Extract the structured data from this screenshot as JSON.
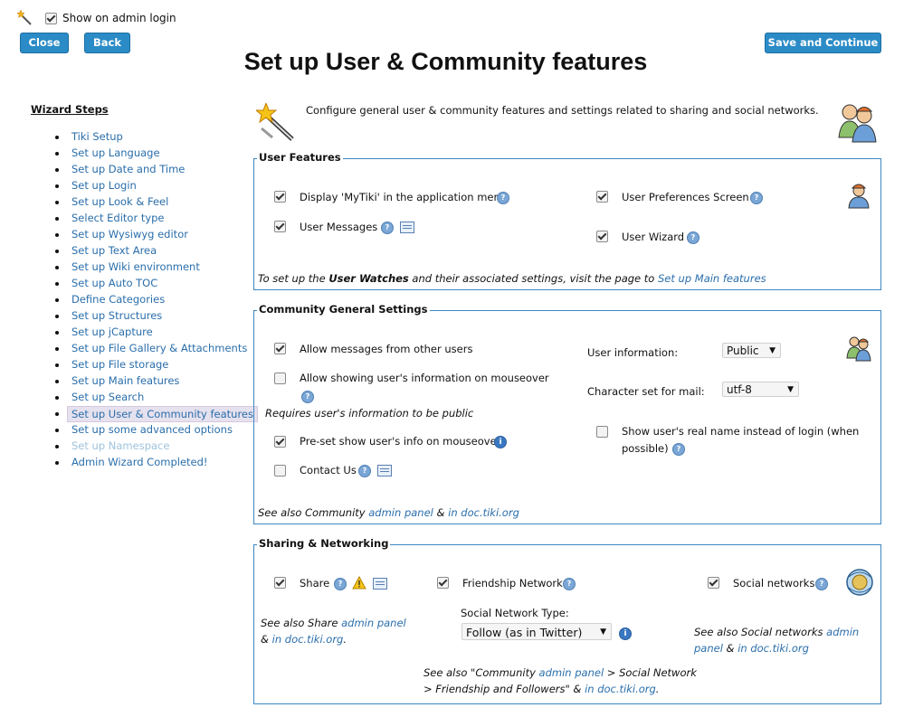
{
  "top": {
    "show_on_admin_login": "Show on admin login",
    "close_label": "Close",
    "back_label": "Back",
    "save_label": "Save and Continue"
  },
  "page_title": "Set up User & Community features",
  "intro": "Configure general user & community features and settings related to sharing and social networks.",
  "wizard_steps": {
    "heading": "Wizard Steps",
    "items": [
      "Tiki Setup",
      "Set up Language",
      "Set up Date and Time",
      "Set up Login",
      "Set up Look & Feel",
      "Select Editor type",
      "Set up Wysiwyg editor",
      "Set up Text Area",
      "Set up Wiki environment",
      "Set up Auto TOC",
      "Define Categories",
      "Set up Structures",
      "Set up jCapture",
      "Set up File Gallery & Attachments",
      "Set up File storage",
      "Set up Main features",
      "Set up Search",
      "Set up User & Community features",
      "Set up some advanced options",
      "Set up Namespace",
      "Admin Wizard Completed!"
    ],
    "active_index": 17,
    "disabled_index": 19
  },
  "user_features": {
    "legend": "User Features",
    "display_mytiki": "Display 'MyTiki' in the application menu",
    "user_messages": "User Messages",
    "user_prefs": "User Preferences Screen",
    "user_wizard": "User Wizard",
    "note_prefix": "To set up the ",
    "note_bold": "User Watches",
    "note_mid": " and their associated settings, visit the page to ",
    "note_link": "Set up Main features"
  },
  "community": {
    "legend": "Community General Settings",
    "allow_messages": "Allow messages from other users",
    "allow_showing": "Allow showing user's information on mouseover",
    "requires_public": "Requires user's information to be public",
    "preset_show": "Pre-set show user's info on mouseover",
    "contact_us": "Contact Us",
    "user_information_label": "User information:",
    "user_information_value": "Public",
    "charset_label": "Character set for mail:",
    "charset_value": "utf-8",
    "real_name_line1": "Show user's real name instead of login (when",
    "real_name_line2": "possible)",
    "see_also_prefix": "See also Community ",
    "admin_panel": "admin panel",
    "amp": " & ",
    "in_doc": "in doc.tiki.org"
  },
  "sharing": {
    "legend": "Sharing & Networking",
    "share": "Share",
    "friendship": "Friendship Network",
    "social_networks": "Social networks",
    "share_see_also": "See also Share ",
    "admin_panel": "admin panel",
    "amp": "& ",
    "in_doc": "in doc.tiki.org",
    "period": ".",
    "snt_label": "Social Network Type:",
    "snt_value": "Follow (as in Twitter)",
    "social_see_also": "See also Social networks ",
    "social_amp": " & ",
    "comm_line1_prefix": "See also \"Community ",
    "comm_line1_suffix": " > Social Network",
    "comm_line2": "> Friendship and Followers\" & "
  },
  "colors": {
    "button": "#2b8bc6",
    "link": "#2a6eab",
    "fieldset_border": "#3d87c1",
    "active_step_bg": "#e6e1ee"
  }
}
